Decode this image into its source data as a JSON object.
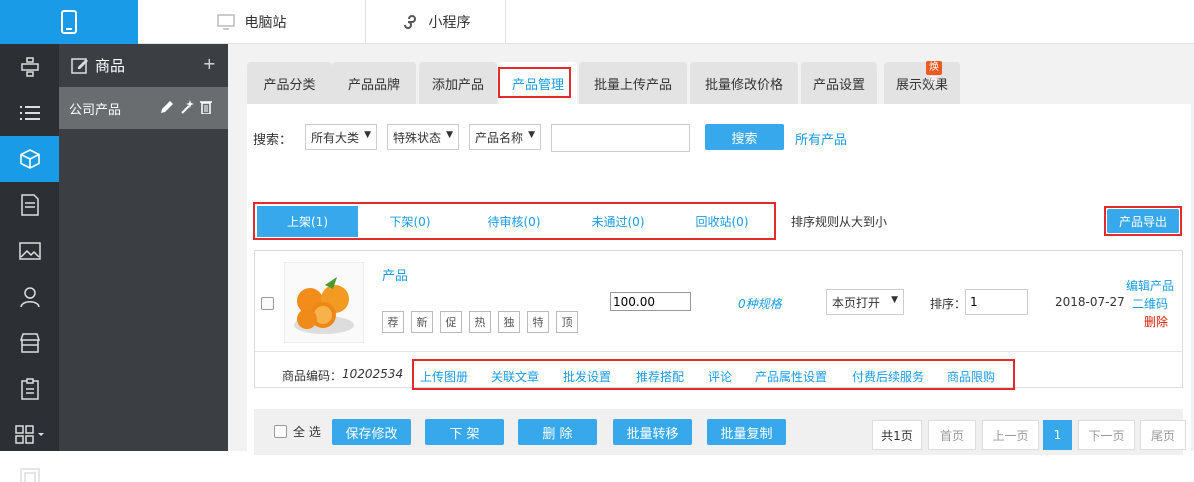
{
  "topbar": {
    "mobile_icon": "phone-icon",
    "pc_label": "电脑站",
    "mini_label": "小程序"
  },
  "panel": {
    "title": "商品",
    "add": "+",
    "item": "公司产品"
  },
  "tabs": [
    {
      "label": "产品分类"
    },
    {
      "label": "产品品牌"
    },
    {
      "label": "添加产品"
    },
    {
      "label": "产品管理"
    },
    {
      "label": "批量上传产品"
    },
    {
      "label": "批量修改价格"
    },
    {
      "label": "产品设置"
    },
    {
      "label": "展示效果"
    }
  ],
  "tab_badge": "焕新",
  "search": {
    "label": "搜索：",
    "category": "所有大类",
    "special": "特殊状态",
    "field": "产品名称",
    "keyword": "",
    "button": "搜索",
    "all_link": "所有产品"
  },
  "status_tabs": [
    {
      "label": "上架(1)"
    },
    {
      "label": "下架(0)"
    },
    {
      "label": "待审核(0)"
    },
    {
      "label": "未通过(0)"
    },
    {
      "label": "回收站(0)"
    }
  ],
  "sort_rule": "排序规则从大到小",
  "export_button": "产品导出",
  "product": {
    "name": "产品",
    "tags": [
      "荐",
      "新",
      "促",
      "热",
      "独",
      "特",
      "顶"
    ],
    "price": "100.00",
    "spec": "0种规格",
    "open_mode": "本页打开",
    "sort_label": "排序：",
    "sort_value": "1",
    "date": "2018-07-27",
    "actions": {
      "edit": "编辑产品",
      "qrcode": "二维码",
      "delete": "删除"
    },
    "code_label": "商品编码：",
    "code_value": "10202534",
    "links": [
      "上传图册",
      "关联文章",
      "批发设置",
      "推荐搭配",
      "评论",
      "产品属性设置",
      "付费后续服务",
      "商品限购"
    ]
  },
  "bulk": {
    "select_all": "全 选",
    "buttons": [
      "保存修改",
      "下 架",
      "删 除",
      "批量转移",
      "批量复制"
    ]
  },
  "pager": {
    "total": "共1页",
    "first": "首页",
    "prev": "上一页",
    "current": "1",
    "next": "下一页",
    "last": "尾页"
  },
  "colors": {
    "accent": "#1a9be8",
    "highlight": "#e32b2b",
    "sidebar": "#2c2f33",
    "badge": "#f05a1e"
  }
}
